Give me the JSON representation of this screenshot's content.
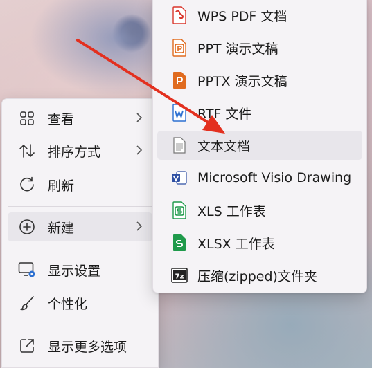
{
  "context_menu": {
    "items": [
      {
        "label": "查看",
        "icon": "grid-view-icon"
      },
      {
        "label": "排序方式",
        "icon": "sort-arrows-icon"
      },
      {
        "label": "刷新",
        "icon": "refresh-icon"
      },
      {
        "label": "新建",
        "icon": "add-circle-icon"
      },
      {
        "label": "显示设置",
        "icon": "display-settings-icon"
      },
      {
        "label": "个性化",
        "icon": "brush-icon"
      },
      {
        "label": "显示更多选项",
        "icon": "open-external-icon"
      }
    ]
  },
  "new_submenu": {
    "items": [
      {
        "label": "WPS PDF 文档",
        "icon": "wps-pdf-icon"
      },
      {
        "label": "PPT 演示文稿",
        "icon": "ppt-icon"
      },
      {
        "label": "PPTX 演示文稿",
        "icon": "pptx-icon"
      },
      {
        "label": "RTF 文件",
        "icon": "rtf-file-icon"
      },
      {
        "label": "文本文档",
        "icon": "text-document-icon"
      },
      {
        "label": "Microsoft Visio Drawing",
        "icon": "visio-icon"
      },
      {
        "label": "XLS 工作表",
        "icon": "xls-icon"
      },
      {
        "label": "XLSX 工作表",
        "icon": "xlsx-icon"
      },
      {
        "label": "压缩(zipped)文件夹",
        "icon": "zip-folder-icon"
      }
    ]
  },
  "colors": {
    "pdf_red": "#d9352b",
    "ppt_orange": "#e06b1f",
    "word_blue": "#2b6fd1",
    "visio_blue": "#2e4fa3",
    "excel_green": "#1f9a4b",
    "annotation_arrow": "#e3301f"
  }
}
